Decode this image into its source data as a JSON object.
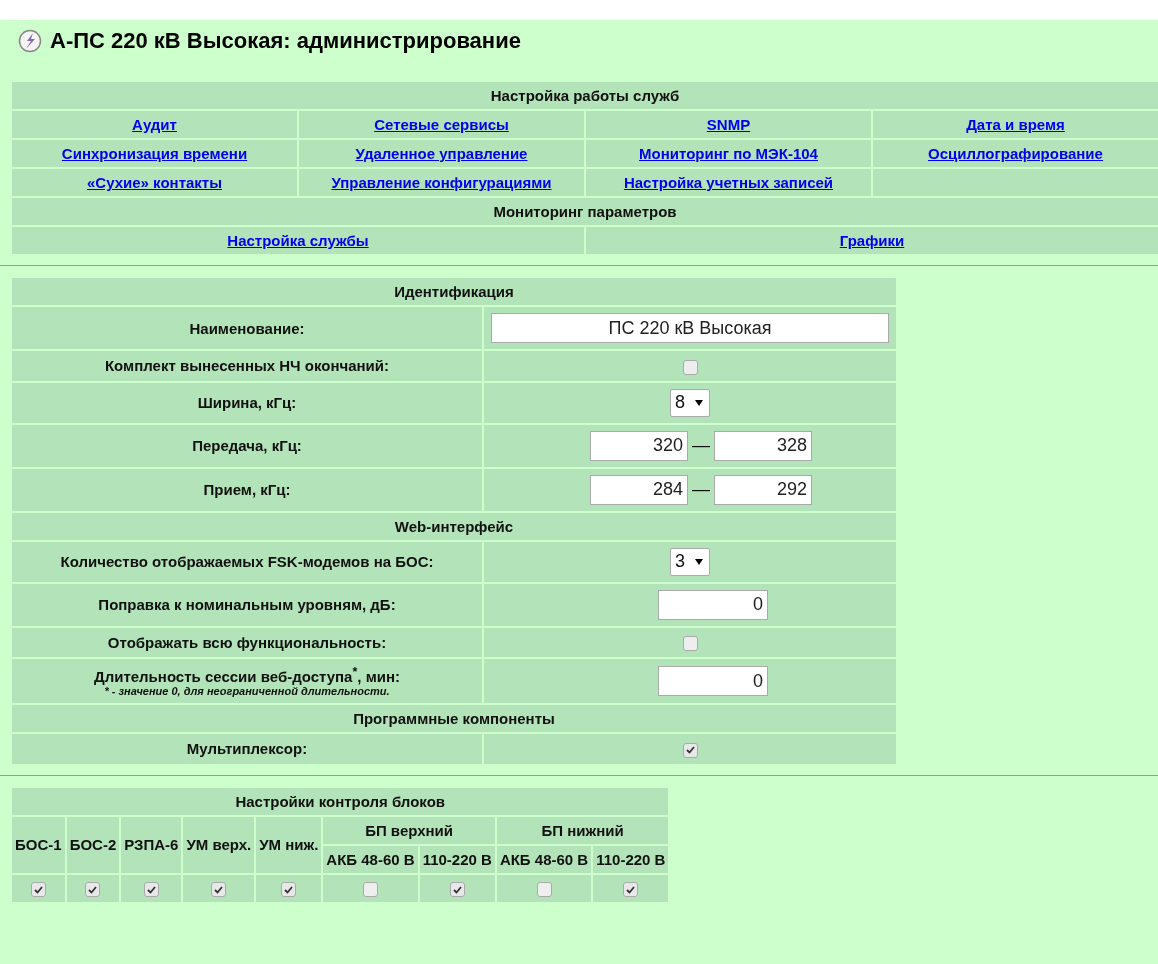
{
  "title": "А-ПС 220 кВ Высокая: администрирование",
  "services": {
    "heading": "Настройка работы служб",
    "rows": [
      [
        "Аудит",
        "Сетевые сервисы",
        "SNMP",
        "Дата и время"
      ],
      [
        "Синхронизация времени",
        "Удаленное управление",
        "Мониторинг по МЭК-104",
        "Осциллографирование"
      ],
      [
        "«Сухие» контакты",
        "Управление конфигурациями",
        "Настройка учетных записей"
      ]
    ]
  },
  "monitoring": {
    "heading": "Мониторинг параметров",
    "links": [
      "Настройка службы",
      "Графики"
    ]
  },
  "settings": [
    {
      "heading": "Идентификация",
      "rows": [
        {
          "kind": "text",
          "label": "Наименование:",
          "value": "ПС 220 кВ Высокая"
        },
        {
          "kind": "checkbox",
          "label": "Комплект вынесенных НЧ окончаний:",
          "checked": false
        },
        {
          "kind": "select",
          "label": "Ширина, кГц:",
          "value": "8"
        },
        {
          "kind": "range",
          "label": "Передача, кГц:",
          "from": "320",
          "separator": "—",
          "to": "328"
        },
        {
          "kind": "range",
          "label": "Прием, кГц:",
          "from": "284",
          "separator": "—",
          "to": "292"
        }
      ]
    },
    {
      "heading": "Web-интерфейс",
      "rows": [
        {
          "kind": "select",
          "label": "Количество отображаемых FSK-модемов на БОС:",
          "value": "3"
        },
        {
          "kind": "number",
          "label": "Поправка к номинальным уровням, дБ:",
          "value": "0"
        },
        {
          "kind": "checkbox",
          "label": "Отображать всю функциональность:",
          "checked": false
        },
        {
          "kind": "number",
          "label": "Длительность сессии веб-доступа$^{*}$, мин:",
          "note": "* - значение 0, для неограниченной длительности.",
          "value": "0"
        }
      ]
    },
    {
      "heading": "Программные компоненты",
      "rows": [
        {
          "kind": "checkbox",
          "label": "Мультиплексор:",
          "checked": true
        }
      ]
    }
  ],
  "blocks": {
    "heading": "Настройки контроля блоков",
    "columns": [
      {
        "kind": "single",
        "label": "БОС-1",
        "checked": true
      },
      {
        "kind": "single",
        "label": "БОС-2",
        "checked": true
      },
      {
        "kind": "single",
        "label": "РЗПА-6",
        "checked": true
      },
      {
        "kind": "single",
        "label": "УМ верх.",
        "checked": true
      },
      {
        "kind": "single",
        "label": "УМ ниж.",
        "checked": true
      },
      {
        "kind": "group",
        "label": "БП верхний",
        "children": [
          {
            "label": "АКБ 48-60 В",
            "checked": false
          },
          {
            "label": "110-220 В",
            "checked": true
          }
        ]
      },
      {
        "kind": "group",
        "label": "БП нижний",
        "children": [
          {
            "label": "АКБ 48-60 В",
            "checked": false
          },
          {
            "label": "110-220 В",
            "checked": true
          }
        ]
      }
    ]
  }
}
